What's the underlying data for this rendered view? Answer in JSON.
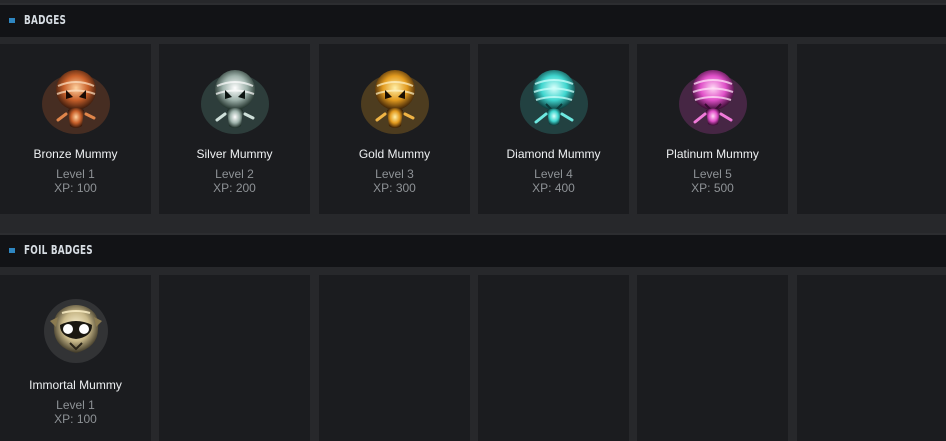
{
  "sections": {
    "badges": {
      "title": "BADGES",
      "items": [
        {
          "name": "Bronze Mummy",
          "level": "Level 1",
          "xp": "XP: 100",
          "icon": "bronze-mummy-icon",
          "color": "#c8602a"
        },
        {
          "name": "Silver Mummy",
          "level": "Level 2",
          "xp": "XP: 200",
          "icon": "silver-mummy-icon",
          "color": "#b9c4c0"
        },
        {
          "name": "Gold Mummy",
          "level": "Level 3",
          "xp": "XP: 300",
          "icon": "gold-mummy-icon",
          "color": "#e39b1f"
        },
        {
          "name": "Diamond Mummy",
          "level": "Level 4",
          "xp": "XP: 400",
          "icon": "diamond-mummy-icon",
          "color": "#3fd6cf"
        },
        {
          "name": "Platinum Mummy",
          "level": "Level 5",
          "xp": "XP: 500",
          "icon": "platinum-mummy-icon",
          "color": "#e04fc8"
        }
      ]
    },
    "foil_badges": {
      "title": "FOIL BADGES",
      "items": [
        {
          "name": "Immortal Mummy",
          "level": "Level 1",
          "xp": "XP: 100",
          "icon": "immortal-mummy-icon",
          "color": "#c9b98a"
        }
      ]
    }
  },
  "colors": {
    "accent": "#2e86c1",
    "card_bg": "#1b1c1f",
    "page_bg": "#27282b",
    "header_bg": "#121316"
  }
}
